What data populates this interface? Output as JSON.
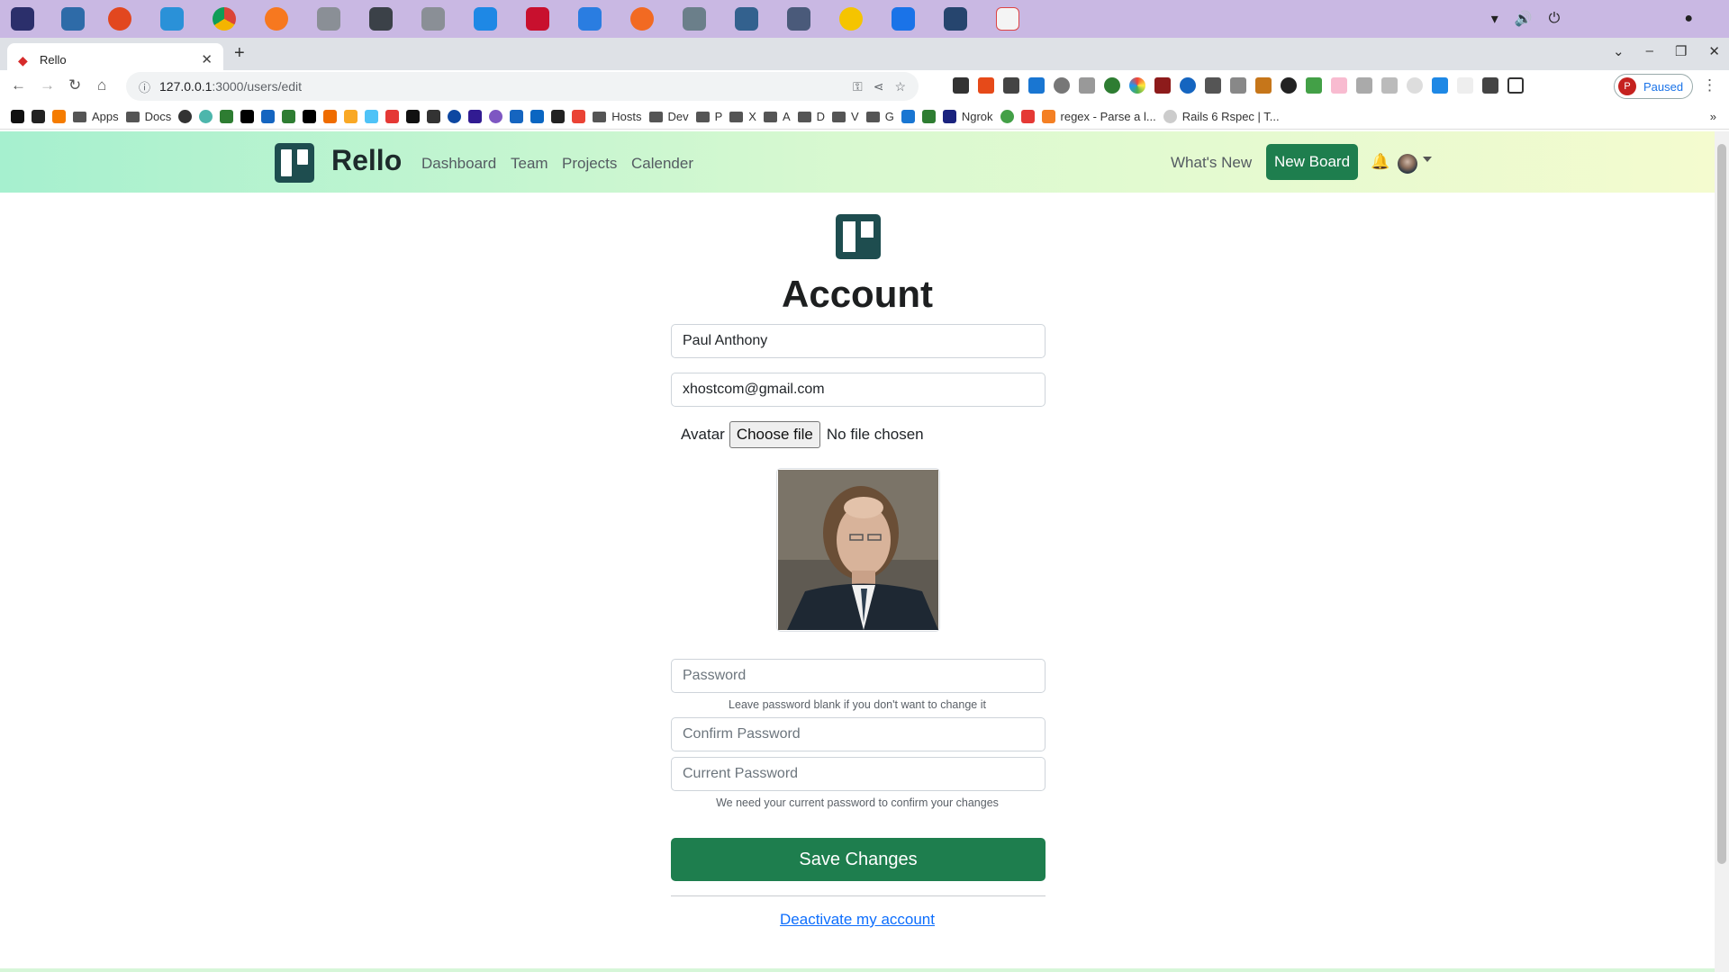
{
  "browser": {
    "tab_title": "Rello",
    "url_host": "127.0.0.1",
    "url_path": ":3000/users/edit",
    "profile_status": "Paused",
    "profile_initial": "P"
  },
  "bookmarks": [
    "Apps",
    "Docs",
    "Hosts",
    "Dev",
    "P",
    "X",
    "A",
    "D",
    "V",
    "G",
    "Ngrok",
    "regex - Parse a l...",
    "Rails 6 Rspec | T..."
  ],
  "app": {
    "brand": "Rello",
    "nav": [
      "Dashboard",
      "Team",
      "Projects",
      "Calender"
    ],
    "whats_new": "What's New",
    "new_board": "New Board"
  },
  "form": {
    "title": "Account",
    "name_value": "Paul Anthony",
    "email_value": "xhostcom@gmail.com",
    "avatar_label": "Avatar",
    "choose_file": "Choose file",
    "no_file": "No file chosen",
    "password_placeholder": "Password",
    "password_hint": "Leave password blank if you don't want to change it",
    "confirm_placeholder": "Confirm Password",
    "current_placeholder": "Current Password",
    "current_hint": "We need your current password to confirm your changes",
    "save": "Save Changes",
    "deactivate": "Deactivate my account"
  },
  "colors": {
    "brand_dark": "#1e4d4f",
    "button_green": "#1e7e4e",
    "link_blue": "#0d6efd"
  }
}
